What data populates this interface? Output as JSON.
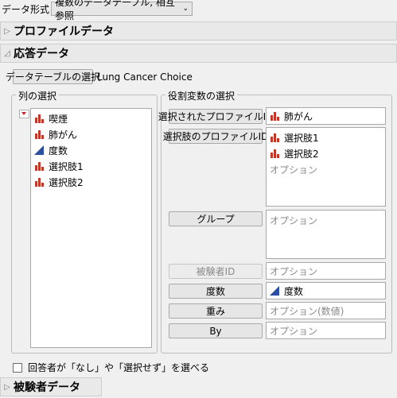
{
  "top": {
    "label": "データ形式",
    "select_value": "複数のデータテーブル, 相互参照"
  },
  "sections": {
    "profile": "プロファイルデータ",
    "response": "応答データ",
    "subject": "被験者データ"
  },
  "response": {
    "select_table_button": "データテーブルの選択",
    "table_name": "Lung Cancer Choice"
  },
  "columns_panel": {
    "title": "列の選択",
    "items": [
      {
        "label": "喫煙",
        "icon": "nominal-bar-icon"
      },
      {
        "label": "肺がん",
        "icon": "nominal-bar-icon"
      },
      {
        "label": "度数",
        "icon": "continuous-triangle-icon"
      },
      {
        "label": "選択肢1",
        "icon": "nominal-bar-icon"
      },
      {
        "label": "選択肢2",
        "icon": "nominal-bar-icon"
      }
    ]
  },
  "roles_panel": {
    "title": "役割変数の選択",
    "roles": {
      "selected_profile_id": {
        "button": "選択されたプロファイルID",
        "values": [
          "肺がん"
        ]
      },
      "choice_profile_id": {
        "button": "選択肢のプロファイルID",
        "values": [
          "選択肢1",
          "選択肢2"
        ],
        "placeholder": "オプション"
      },
      "group": {
        "button": "グループ",
        "placeholder": "オプション"
      },
      "subject_id": {
        "button": "被験者ID",
        "placeholder": "オプション"
      },
      "freq": {
        "button": "度数",
        "values": [
          "度数"
        ]
      },
      "weight": {
        "button": "重み",
        "placeholder": "オプション(数値)"
      },
      "by": {
        "button": "By",
        "placeholder": "オプション"
      }
    }
  },
  "checkbox": {
    "label": "回答者が「なし」や「選択せず」を選べる",
    "checked": false
  },
  "colors": {
    "nominal_icon": "#c0392b",
    "continuous_icon": "#2b4fa0",
    "red_triangle": "#d42020"
  }
}
